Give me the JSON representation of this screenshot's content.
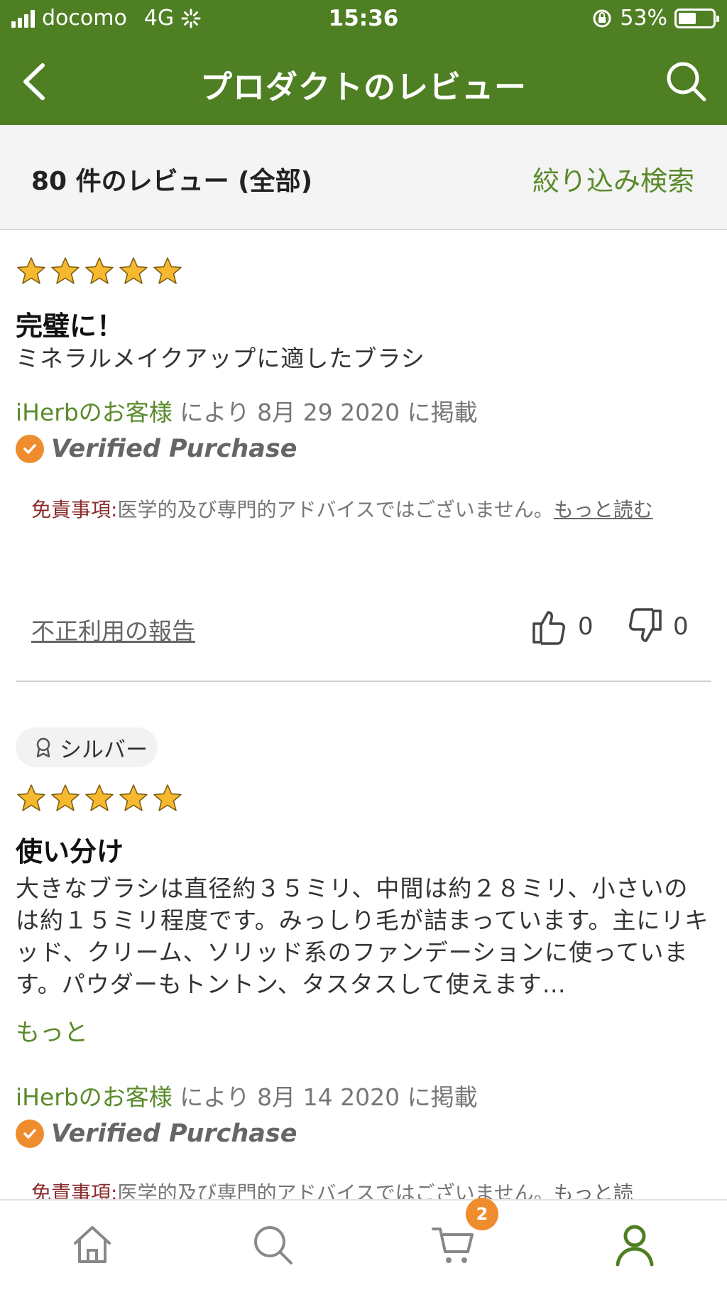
{
  "status_bar": {
    "carrier": "docomo",
    "network": "4G",
    "time": "15:36",
    "battery_percent": "53%",
    "battery_level": 0.53
  },
  "nav": {
    "title": "プロダクトのレビュー",
    "back_icon": "chevron-left-icon",
    "search_icon": "search-icon"
  },
  "filter_bar": {
    "count_label": "80 件のレビュー (全部)",
    "filter_label": "絞り込み検索"
  },
  "reviews": [
    {
      "rating": 5,
      "title": "完璧に！",
      "body": "ミネラルメイクアップに適したブラシ",
      "author": "iHerbのお客様",
      "date_text": " により 8月 29 2020 に掲載",
      "verified_label": "Verified Purchase",
      "disclaimer_label": "免責事項:",
      "disclaimer_text": "医学的及び専門的アドバイスではございません。",
      "disclaimer_more": "もっと読む",
      "report_label": "不正利用の報告",
      "likes": "0",
      "dislikes": "0"
    },
    {
      "rank_badge": "シルバー",
      "rating": 5,
      "title": "使い分け",
      "body": "大きなブラシは直径約３５ミリ、中間は約２８ミリ、小さいのは約１５ミリ程度です。みっしり毛が詰まっています。主にリキッド、クリーム、ソリッド系のファンデーションに使っています。パウダーもトントン、タスタスして使えます…",
      "more_label": "もっと",
      "author": "iHerbのお客様",
      "date_text": " により 8月 14 2020 に掲載",
      "verified_label": "Verified Purchase",
      "disclaimer_label": "免責事項:",
      "disclaimer_text": "医学的及び専門的アドバイスではございません。",
      "disclaimer_more": "もっと読"
    }
  ],
  "tab_bar": {
    "tabs": [
      "home-icon",
      "search-icon",
      "cart-icon",
      "account-icon"
    ],
    "cart_count": "2",
    "active_color": "#4f7f23"
  },
  "colors": {
    "brand_green": "#4f7f23",
    "link_green": "#5a8a2a",
    "star_gold": "#f5b82e",
    "verified_orange": "#ef8c2e"
  }
}
